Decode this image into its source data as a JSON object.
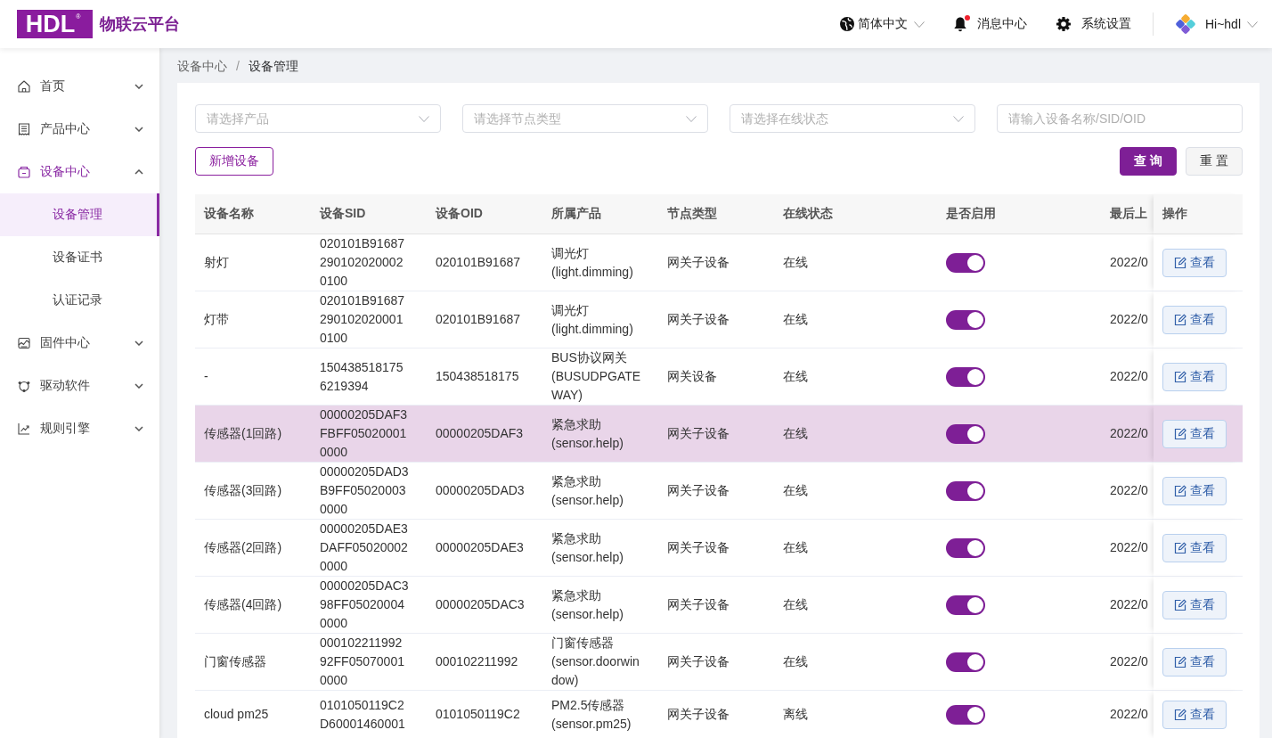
{
  "header": {
    "logo": "HDL$^{®}$",
    "title": "物联云平台",
    "language": {
      "label": "简体中文"
    },
    "messages": {
      "label": "消息中心",
      "unread": true
    },
    "settings": {
      "label": "系统设置"
    },
    "user": {
      "greeting": "Hi~hdl"
    }
  },
  "sidebar": {
    "items": [
      {
        "label": "首页",
        "active": false,
        "expanded": false
      },
      {
        "label": "产品中心",
        "active": false,
        "expanded": false
      },
      {
        "label": "设备中心",
        "active": true,
        "expanded": true,
        "children": [
          {
            "label": "设备管理",
            "selected": true
          },
          {
            "label": "设备证书",
            "selected": false
          },
          {
            "label": "认证记录",
            "selected": false
          }
        ]
      },
      {
        "label": "固件中心",
        "active": false,
        "expanded": false
      },
      {
        "label": "驱动软件",
        "active": false,
        "expanded": false
      },
      {
        "label": "规则引擎",
        "active": false,
        "expanded": false
      }
    ]
  },
  "breadcrumb": {
    "items": [
      "设备中心",
      "设备管理"
    ],
    "separator": "/"
  },
  "filters": [
    {
      "kind": "select",
      "placeholder": "请选择产品"
    },
    {
      "kind": "select",
      "placeholder": "请选择节点类型"
    },
    {
      "kind": "select",
      "placeholder": "请选择在线状态"
    },
    {
      "kind": "input",
      "placeholder": "请输入设备名称/SID/OID"
    }
  ],
  "buttons": {
    "add": "新增设备",
    "query": "查 询",
    "reset": "重 置"
  },
  "table": {
    "columns": [
      "设备名称",
      "设备SID",
      "设备OID",
      "所属产品",
      "节点类型",
      "在线状态",
      "是否启用",
      "最后上",
      "操作"
    ],
    "rows": [
      {
        "name": "射灯",
        "sid": "020101B916872901020200020100",
        "oid": "020101B91687",
        "product": "调光灯(light.dimming)",
        "node_type": "网关子设备",
        "status": "在线",
        "enabled": true,
        "last_online": "2022/0",
        "action": "查看",
        "selected": false
      },
      {
        "name": "灯带",
        "sid": "020101B916872901020200010100",
        "oid": "020101B91687",
        "product": "调光灯(light.dimming)",
        "node_type": "网关子设备",
        "status": "在线",
        "enabled": true,
        "last_online": "2022/0",
        "action": "查看",
        "selected": false
      },
      {
        "name": "-",
        "sid": "1504385181756219394",
        "oid": "150438518175",
        "product": "BUS协议网关(BUSUDPGATEWAY)",
        "node_type": "网关设备",
        "status": "在线",
        "enabled": true,
        "last_online": "2022/0",
        "action": "查看",
        "selected": false
      },
      {
        "name": "传感器(1回路)",
        "sid": "00000205DAF3FBFF050200010000",
        "oid": "00000205DAF3",
        "product": "紧急求助(sensor.help)",
        "node_type": "网关子设备",
        "status": "在线",
        "enabled": true,
        "last_online": "2022/0",
        "action": "查看",
        "selected": true
      },
      {
        "name": "传感器(3回路)",
        "sid": "00000205DAD3B9FF050200030000",
        "oid": "00000205DAD3",
        "product": "紧急求助(sensor.help)",
        "node_type": "网关子设备",
        "status": "在线",
        "enabled": true,
        "last_online": "2022/0",
        "action": "查看",
        "selected": false
      },
      {
        "name": "传感器(2回路)",
        "sid": "00000205DAE3DAFF050200020000",
        "oid": "00000205DAE3",
        "product": "紧急求助(sensor.help)",
        "node_type": "网关子设备",
        "status": "在线",
        "enabled": true,
        "last_online": "2022/0",
        "action": "查看",
        "selected": false
      },
      {
        "name": "传感器(4回路)",
        "sid": "00000205DAC398FF050200040000",
        "oid": "00000205DAC3",
        "product": "紧急求助(sensor.help)",
        "node_type": "网关子设备",
        "status": "在线",
        "enabled": true,
        "last_online": "2022/0",
        "action": "查看",
        "selected": false
      },
      {
        "name": "门窗传感器",
        "sid": "00010221199292FF050700010000",
        "oid": "000102211992",
        "product": "门窗传感器(sensor.doorwindow)",
        "node_type": "网关子设备",
        "status": "在线",
        "enabled": true,
        "last_online": "2022/0",
        "action": "查看",
        "selected": false
      },
      {
        "name": "cloud pm25",
        "sid": "0101050119C2D60001460001",
        "oid": "0101050119C2",
        "product": "PM2.5传感器(sensor.pm25)",
        "node_type": "网关子设备",
        "status": "离线",
        "enabled": true,
        "last_online": "2022/0",
        "action": "查看",
        "selected": false
      }
    ]
  }
}
